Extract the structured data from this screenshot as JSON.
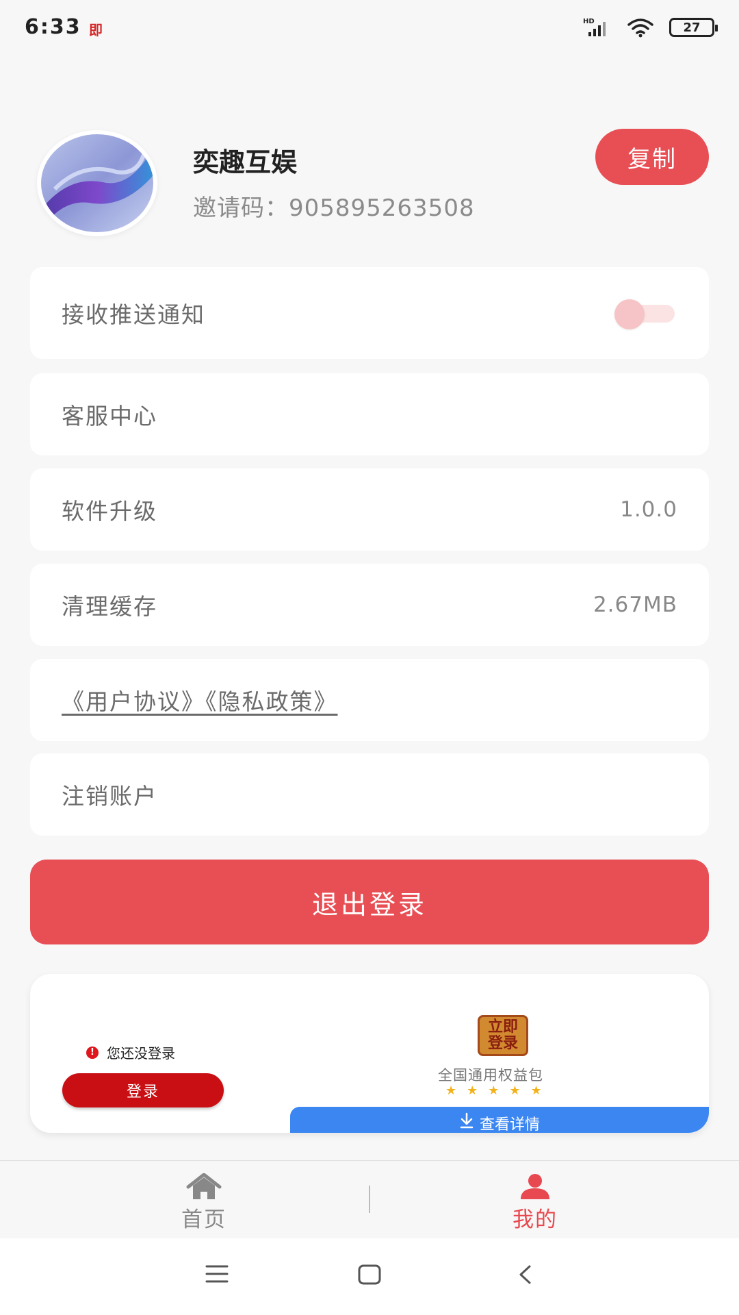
{
  "status_bar": {
    "time": "6:33",
    "notification": "即",
    "network": "HD",
    "battery": "27"
  },
  "profile": {
    "name": "奕趣互娱",
    "invite_label": "邀请码：",
    "invite_code": "905895263508",
    "copy_label": "复制"
  },
  "settings": {
    "push": {
      "label": "接收推送通知",
      "enabled": false
    },
    "service": {
      "label": "客服中心"
    },
    "upgrade": {
      "label": "软件升级",
      "value": "1.0.0"
    },
    "cache": {
      "label": "清理缓存",
      "value": "2.67MB"
    },
    "agreement": {
      "label": "《用户协议》《隐私政策》"
    },
    "cancel_account": {
      "label": "注销账户"
    }
  },
  "logout_label": "退出登录",
  "ad": {
    "warning_text": "您还没登录",
    "login_label": "登录",
    "stamp_text": "立即登录",
    "promo_text": "全国通用权益包",
    "rating": 5,
    "detail_label": "查看详情"
  },
  "bottom_nav": {
    "items": [
      {
        "label": "首页",
        "icon": "home-icon",
        "active": false
      },
      {
        "label": "我的",
        "icon": "person-icon",
        "active": true
      }
    ],
    "active_color": "#e8484f",
    "inactive_color": "#888888"
  },
  "colors": {
    "accent": "#e84f55",
    "ad_button": "#c90f14",
    "ad_detail": "#3b86f0"
  }
}
